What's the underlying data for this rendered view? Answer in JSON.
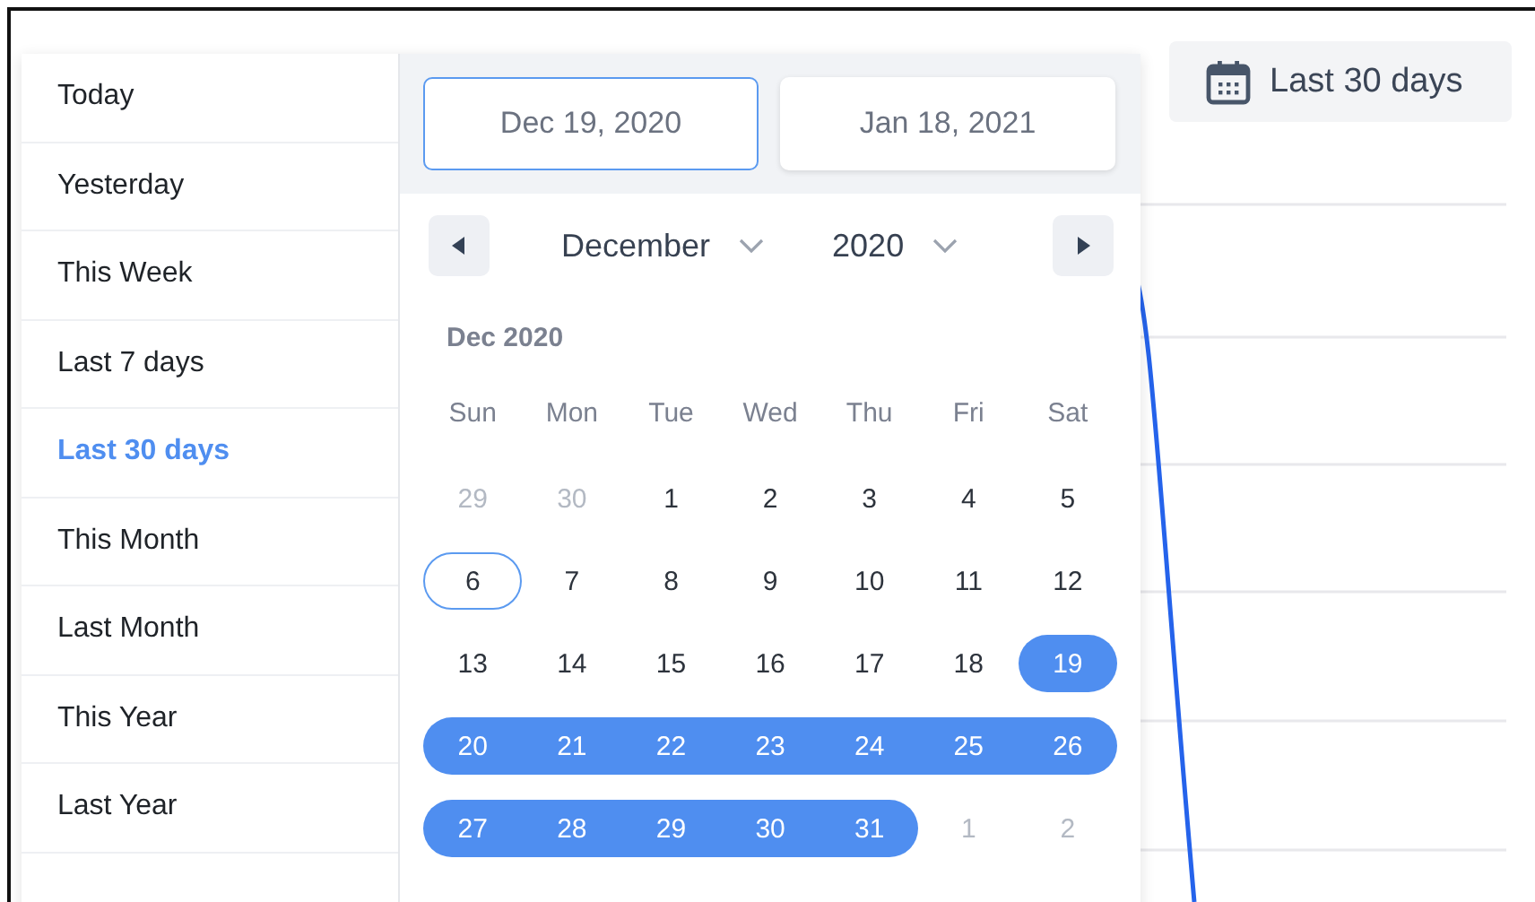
{
  "range_button": {
    "label": "Last 30 days"
  },
  "presets": [
    {
      "label": "Today",
      "selected": false
    },
    {
      "label": "Yesterday",
      "selected": false
    },
    {
      "label": "This Week",
      "selected": false
    },
    {
      "label": "Last 7 days",
      "selected": false
    },
    {
      "label": "Last 30 days",
      "selected": true
    },
    {
      "label": "This Month",
      "selected": false
    },
    {
      "label": "Last Month",
      "selected": false
    },
    {
      "label": "This Year",
      "selected": false
    },
    {
      "label": "Last Year",
      "selected": false
    }
  ],
  "start_date": {
    "value": "Dec 19, 2020",
    "focused": true
  },
  "end_date": {
    "value": "Jan 18, 2021",
    "focused": false
  },
  "month_select": "December",
  "year_select": "2020",
  "caption": "Dec 2020",
  "weekdays": [
    "Sun",
    "Mon",
    "Tue",
    "Wed",
    "Thu",
    "Fri",
    "Sat"
  ],
  "weeks": [
    [
      {
        "label": "29",
        "muted": true,
        "selected": false,
        "today": false
      },
      {
        "label": "30",
        "muted": true,
        "selected": false,
        "today": false
      },
      {
        "label": "1",
        "muted": false,
        "selected": false,
        "today": false
      },
      {
        "label": "2",
        "muted": false,
        "selected": false,
        "today": false
      },
      {
        "label": "3",
        "muted": false,
        "selected": false,
        "today": false
      },
      {
        "label": "4",
        "muted": false,
        "selected": false,
        "today": false
      },
      {
        "label": "5",
        "muted": false,
        "selected": false,
        "today": false
      }
    ],
    [
      {
        "label": "6",
        "muted": false,
        "selected": false,
        "today": true
      },
      {
        "label": "7",
        "muted": false,
        "selected": false,
        "today": false
      },
      {
        "label": "8",
        "muted": false,
        "selected": false,
        "today": false
      },
      {
        "label": "9",
        "muted": false,
        "selected": false,
        "today": false
      },
      {
        "label": "10",
        "muted": false,
        "selected": false,
        "today": false
      },
      {
        "label": "11",
        "muted": false,
        "selected": false,
        "today": false
      },
      {
        "label": "12",
        "muted": false,
        "selected": false,
        "today": false
      }
    ],
    [
      {
        "label": "13",
        "muted": false,
        "selected": false,
        "today": false
      },
      {
        "label": "14",
        "muted": false,
        "selected": false,
        "today": false
      },
      {
        "label": "15",
        "muted": false,
        "selected": false,
        "today": false
      },
      {
        "label": "16",
        "muted": false,
        "selected": false,
        "today": false
      },
      {
        "label": "17",
        "muted": false,
        "selected": false,
        "today": false
      },
      {
        "label": "18",
        "muted": false,
        "selected": false,
        "today": false
      },
      {
        "label": "19",
        "muted": false,
        "selected": true,
        "today": false
      }
    ],
    [
      {
        "label": "20",
        "muted": false,
        "selected": true,
        "today": false
      },
      {
        "label": "21",
        "muted": false,
        "selected": true,
        "today": false
      },
      {
        "label": "22",
        "muted": false,
        "selected": true,
        "today": false
      },
      {
        "label": "23",
        "muted": false,
        "selected": true,
        "today": false
      },
      {
        "label": "24",
        "muted": false,
        "selected": true,
        "today": false
      },
      {
        "label": "25",
        "muted": false,
        "selected": true,
        "today": false
      },
      {
        "label": "26",
        "muted": false,
        "selected": true,
        "today": false
      }
    ],
    [
      {
        "label": "27",
        "muted": false,
        "selected": true,
        "today": false
      },
      {
        "label": "28",
        "muted": false,
        "selected": true,
        "today": false
      },
      {
        "label": "29",
        "muted": false,
        "selected": true,
        "today": false
      },
      {
        "label": "30",
        "muted": false,
        "selected": true,
        "today": false
      },
      {
        "label": "31",
        "muted": false,
        "selected": true,
        "today": false
      },
      {
        "label": "1",
        "muted": true,
        "selected": false,
        "today": false
      },
      {
        "label": "2",
        "muted": true,
        "selected": false,
        "today": false
      }
    ]
  ]
}
